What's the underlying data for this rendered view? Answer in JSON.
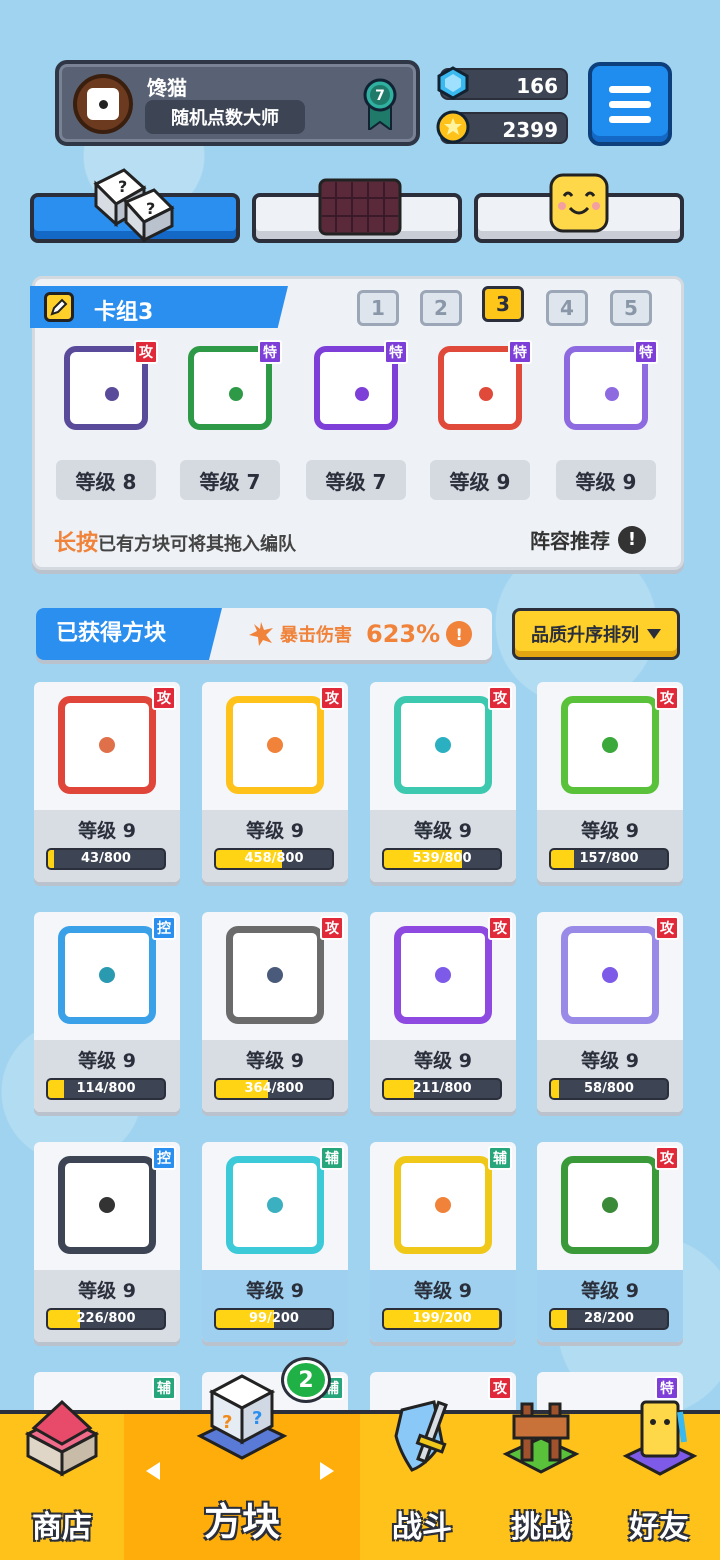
{
  "player": {
    "name": "馋猫",
    "title": "随机点数大师",
    "rank": "7"
  },
  "currency": {
    "gems": "166",
    "coins": "2399"
  },
  "deck": {
    "title": "卡组3",
    "tabs": [
      "1",
      "2",
      "3",
      "4",
      "5"
    ],
    "active_tab": 2,
    "cards": [
      {
        "level": "等级 8",
        "tag": "攻",
        "tag_type": "atk",
        "color": "#5a4a9a"
      },
      {
        "level": "等级 7",
        "tag": "特",
        "tag_type": "spc",
        "color": "#2e9a48"
      },
      {
        "level": "等级 7",
        "tag": "特",
        "tag_type": "spc",
        "color": "#7d3fd8"
      },
      {
        "level": "等级 9",
        "tag": "特",
        "tag_type": "spc",
        "color": "#e04a3a"
      },
      {
        "level": "等级 9",
        "tag": "特",
        "tag_type": "spc",
        "color": "#8e6ae0"
      }
    ],
    "hint_highlight": "长按",
    "hint_rest": "已有方块可将其拖入编队",
    "recommend": "阵容推荐"
  },
  "owned": {
    "title": "已获得方块",
    "crit_label": "暴击伤害",
    "crit_value": "623%",
    "sort_label": "品质升序排列"
  },
  "cards": [
    {
      "level": "等级 9",
      "progress": "43/800",
      "fraction": 0.05,
      "tag": "攻",
      "tag_type": "atk",
      "border": "#e0453a",
      "dot": "#e0704a",
      "blue": false
    },
    {
      "level": "等级 9",
      "progress": "458/800",
      "fraction": 0.57,
      "tag": "攻",
      "tag_type": "atk",
      "border": "#ffc21a",
      "dot": "#f0823a",
      "blue": false
    },
    {
      "level": "等级 9",
      "progress": "539/800",
      "fraction": 0.67,
      "tag": "攻",
      "tag_type": "atk",
      "border": "#3cc9b0",
      "dot": "#2ab0c0",
      "blue": false
    },
    {
      "level": "等级 9",
      "progress": "157/800",
      "fraction": 0.2,
      "tag": "攻",
      "tag_type": "atk",
      "border": "#5ac23a",
      "dot": "#3aa83a",
      "blue": false
    },
    {
      "level": "等级 9",
      "progress": "114/800",
      "fraction": 0.14,
      "tag": "控",
      "tag_type": "ctl",
      "border": "#3aa0e8",
      "dot": "#2a9ab0",
      "blue": false
    },
    {
      "level": "等级 9",
      "progress": "364/800",
      "fraction": 0.45,
      "tag": "攻",
      "tag_type": "atk",
      "border": "#6b6b6b",
      "dot": "#4a5a7a",
      "blue": false
    },
    {
      "level": "等级 9",
      "progress": "211/800",
      "fraction": 0.26,
      "tag": "攻",
      "tag_type": "atk",
      "border": "#8e4ae0",
      "dot": "#7d5ae8",
      "blue": false
    },
    {
      "level": "等级 9",
      "progress": "58/800",
      "fraction": 0.07,
      "tag": "攻",
      "tag_type": "atk",
      "border": "#9a8ae8",
      "dot": "#7d5ae8",
      "blue": false
    },
    {
      "level": "等级 9",
      "progress": "226/800",
      "fraction": 0.28,
      "tag": "控",
      "tag_type": "ctl",
      "border": "#3d4454",
      "dot": "#333",
      "blue": false
    },
    {
      "level": "等级 9",
      "progress": "99/200",
      "fraction": 0.5,
      "tag": "辅",
      "tag_type": "sup",
      "border": "#3cc9d8",
      "dot": "#3ab0c0",
      "blue": true
    },
    {
      "level": "等级 9",
      "progress": "199/200",
      "fraction": 0.99,
      "tag": "辅",
      "tag_type": "sup",
      "border": "#f0c81a",
      "dot": "#f0823a",
      "blue": true
    },
    {
      "level": "等级 9",
      "progress": "28/200",
      "fraction": 0.14,
      "tag": "攻",
      "tag_type": "atk",
      "border": "#3a9a3a",
      "dot": "#3a8a3a",
      "blue": true
    }
  ],
  "peek_tags": [
    {
      "tag": "辅",
      "tag_type": "sup"
    },
    {
      "tag": "辅",
      "tag_type": "sup"
    },
    {
      "tag": "攻",
      "tag_type": "atk"
    },
    {
      "tag": "特",
      "tag_type": "spc"
    }
  ],
  "nav": {
    "shop": "商店",
    "blocks": "方块",
    "battle": "战斗",
    "challenge": "挑战",
    "friends": "好友",
    "blocks_badge": "2"
  }
}
